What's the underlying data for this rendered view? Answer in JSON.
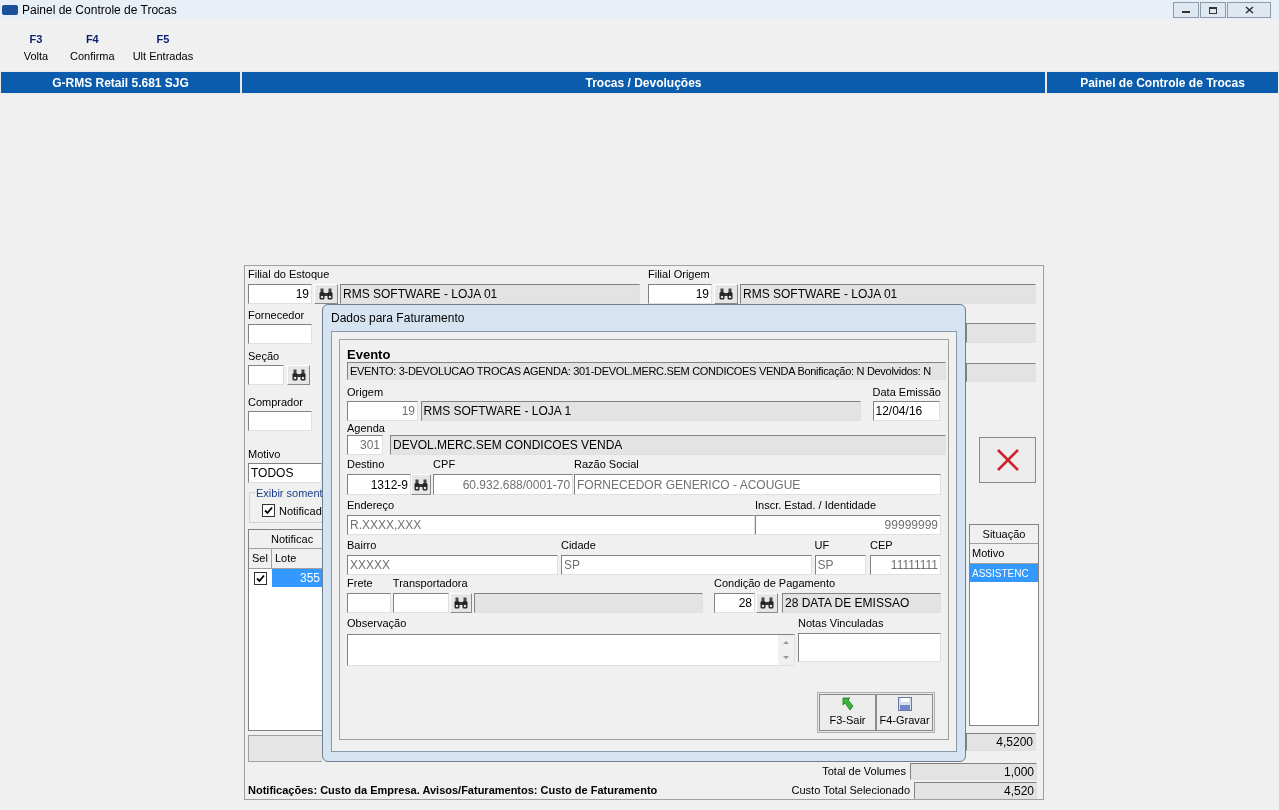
{
  "window": {
    "title": "Painel de Controle de Trocas"
  },
  "toolbar": [
    {
      "key": "F3",
      "label": "Volta"
    },
    {
      "key": "F4",
      "label": "Confirma"
    },
    {
      "key": "F5",
      "label": "Ult Entradas"
    }
  ],
  "header_bar": [
    "G-RMS Retail 5.681 SJG",
    "Trocas / Devoluções",
    "Painel de Controle de Trocas"
  ],
  "filters": {
    "filial_estoque": {
      "label": "Filial do Estoque",
      "code": "19",
      "name": "RMS SOFTWARE - LOJA 01"
    },
    "filial_origem": {
      "label": "Filial Origem",
      "code": "19",
      "name": "RMS SOFTWARE - LOJA 01"
    },
    "fornecedor": {
      "label": "Fornecedor"
    },
    "secao": {
      "label": "Seção"
    },
    "comprador": {
      "label": "Comprador"
    },
    "motivo": {
      "label": "Motivo",
      "value": "TODOS"
    },
    "exibir": {
      "legend": "Exibir soment",
      "options": [
        {
          "label": "Notificad",
          "checked": true
        }
      ]
    }
  },
  "table": {
    "group_header": "Notificac",
    "columns": [
      "Sel",
      "Lote"
    ],
    "right_group_header": "Situação",
    "right_column": "Motivo",
    "rows": [
      {
        "checked": true,
        "lote": "355",
        "motivo": "ASSISTENC",
        "selected": true
      }
    ]
  },
  "totals": [
    {
      "value": "4,5200"
    },
    {
      "label": "Total de Volumes",
      "value": "1,000"
    },
    {
      "label": "Custo Total Selecionado",
      "value": "4,520"
    }
  ],
  "footnote": "Notificações: Custo da Empresa. Avisos/Faturamentos: Custo de Faturamento",
  "dialog": {
    "title": "Dados para Faturamento",
    "evento": {
      "label": "Evento",
      "value": "EVENTO: 3-DEVOLUCAO TROCAS AGENDA: 301-DEVOL.MERC.SEM CONDICOES VENDA Bonificação: N Devolvidos: N"
    },
    "origem": {
      "label": "Origem",
      "code": "19",
      "name": "RMS SOFTWARE - LOJA 1"
    },
    "data_emissao": {
      "label": "Data Emissão",
      "value": "12/04/16"
    },
    "agenda": {
      "label": "Agenda",
      "code": "301",
      "name": "DEVOL.MERC.SEM CONDICOES VENDA"
    },
    "destino": {
      "label": "Destino",
      "value": "1312-9"
    },
    "cpf": {
      "label": "CPF",
      "value": "60.932.688/0001-70"
    },
    "razao_social": {
      "label": "Razão Social",
      "value": "FORNECEDOR GENERICO - ACOUGUE"
    },
    "endereco": {
      "label": "Endereço",
      "value": "R.XXXX,XXX"
    },
    "inscricao": {
      "label": "Inscr. Estad. / Identidade",
      "value": "99999999"
    },
    "bairro": {
      "label": "Bairro",
      "value": "XXXXX"
    },
    "cidade": {
      "label": "Cidade",
      "value": "SP"
    },
    "uf": {
      "label": "UF",
      "value": "SP"
    },
    "cep": {
      "label": "CEP",
      "value": "11111111"
    },
    "frete": {
      "label": "Frete"
    },
    "transportadora": {
      "label": "Transportadora"
    },
    "condicao": {
      "label": "Condição de Pagamento",
      "code": "28",
      "name": "28 DATA DE EMISSAO"
    },
    "observacao": {
      "label": "Observação"
    },
    "notas": {
      "label": "Notas Vinculadas"
    },
    "buttons": [
      {
        "kind": "exit",
        "label": "F3-Sair"
      },
      {
        "kind": "save",
        "label": "F4-Gravar"
      }
    ]
  }
}
